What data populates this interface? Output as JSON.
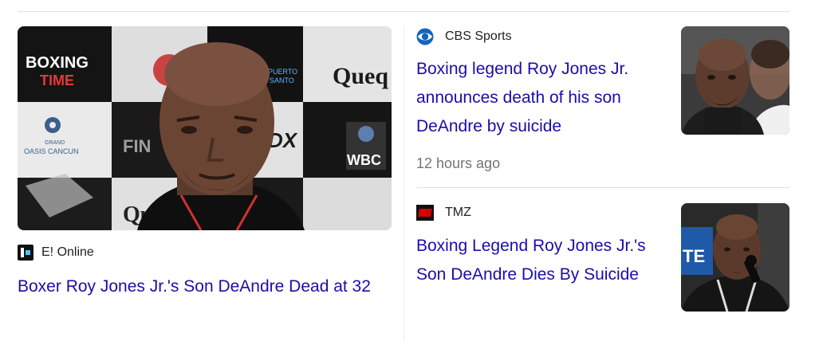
{
  "cards": {
    "main": {
      "source": "E! Online",
      "source_icon": "eonline-logo-icon",
      "headline": "Boxer Roy Jones Jr.'s Son DeAndre Dead at 32",
      "image": "boxer-portrait-image",
      "backdrop_text": {
        "line1": "BOXING",
        "line2": "TIME",
        "brand": "Queq",
        "wbc": "WBC",
        "fin": "FIN",
        "dx": "DX",
        "qui": "Qu",
        "grand": "GRAND",
        "oasis": "OASIS CANCUN",
        "puerto": "PUERTO",
        "santo": "SANTO"
      }
    },
    "cbs": {
      "source": "CBS Sports",
      "source_icon": "cbs-eye-logo-icon",
      "headline": "Boxing legend Roy Jones Jr. announces death of his son DeAndre by suicide",
      "timestamp": "12 hours ago",
      "image": "boxer-thumbnail-image",
      "brand_color": "#1565c0"
    },
    "tmz": {
      "source": "TMZ",
      "source_icon": "tmz-logo-icon",
      "headline": "Boxing Legend Roy Jones Jr.'s Son DeAndre Dies By Suicide",
      "image": "boxer-press-conference-image",
      "backdrop_text": "TE",
      "brand_color": "#d50000"
    }
  },
  "colors": {
    "link": "#1a0dab",
    "meta": "#70757a",
    "text": "#202124",
    "divider": "#e0e0e0"
  }
}
